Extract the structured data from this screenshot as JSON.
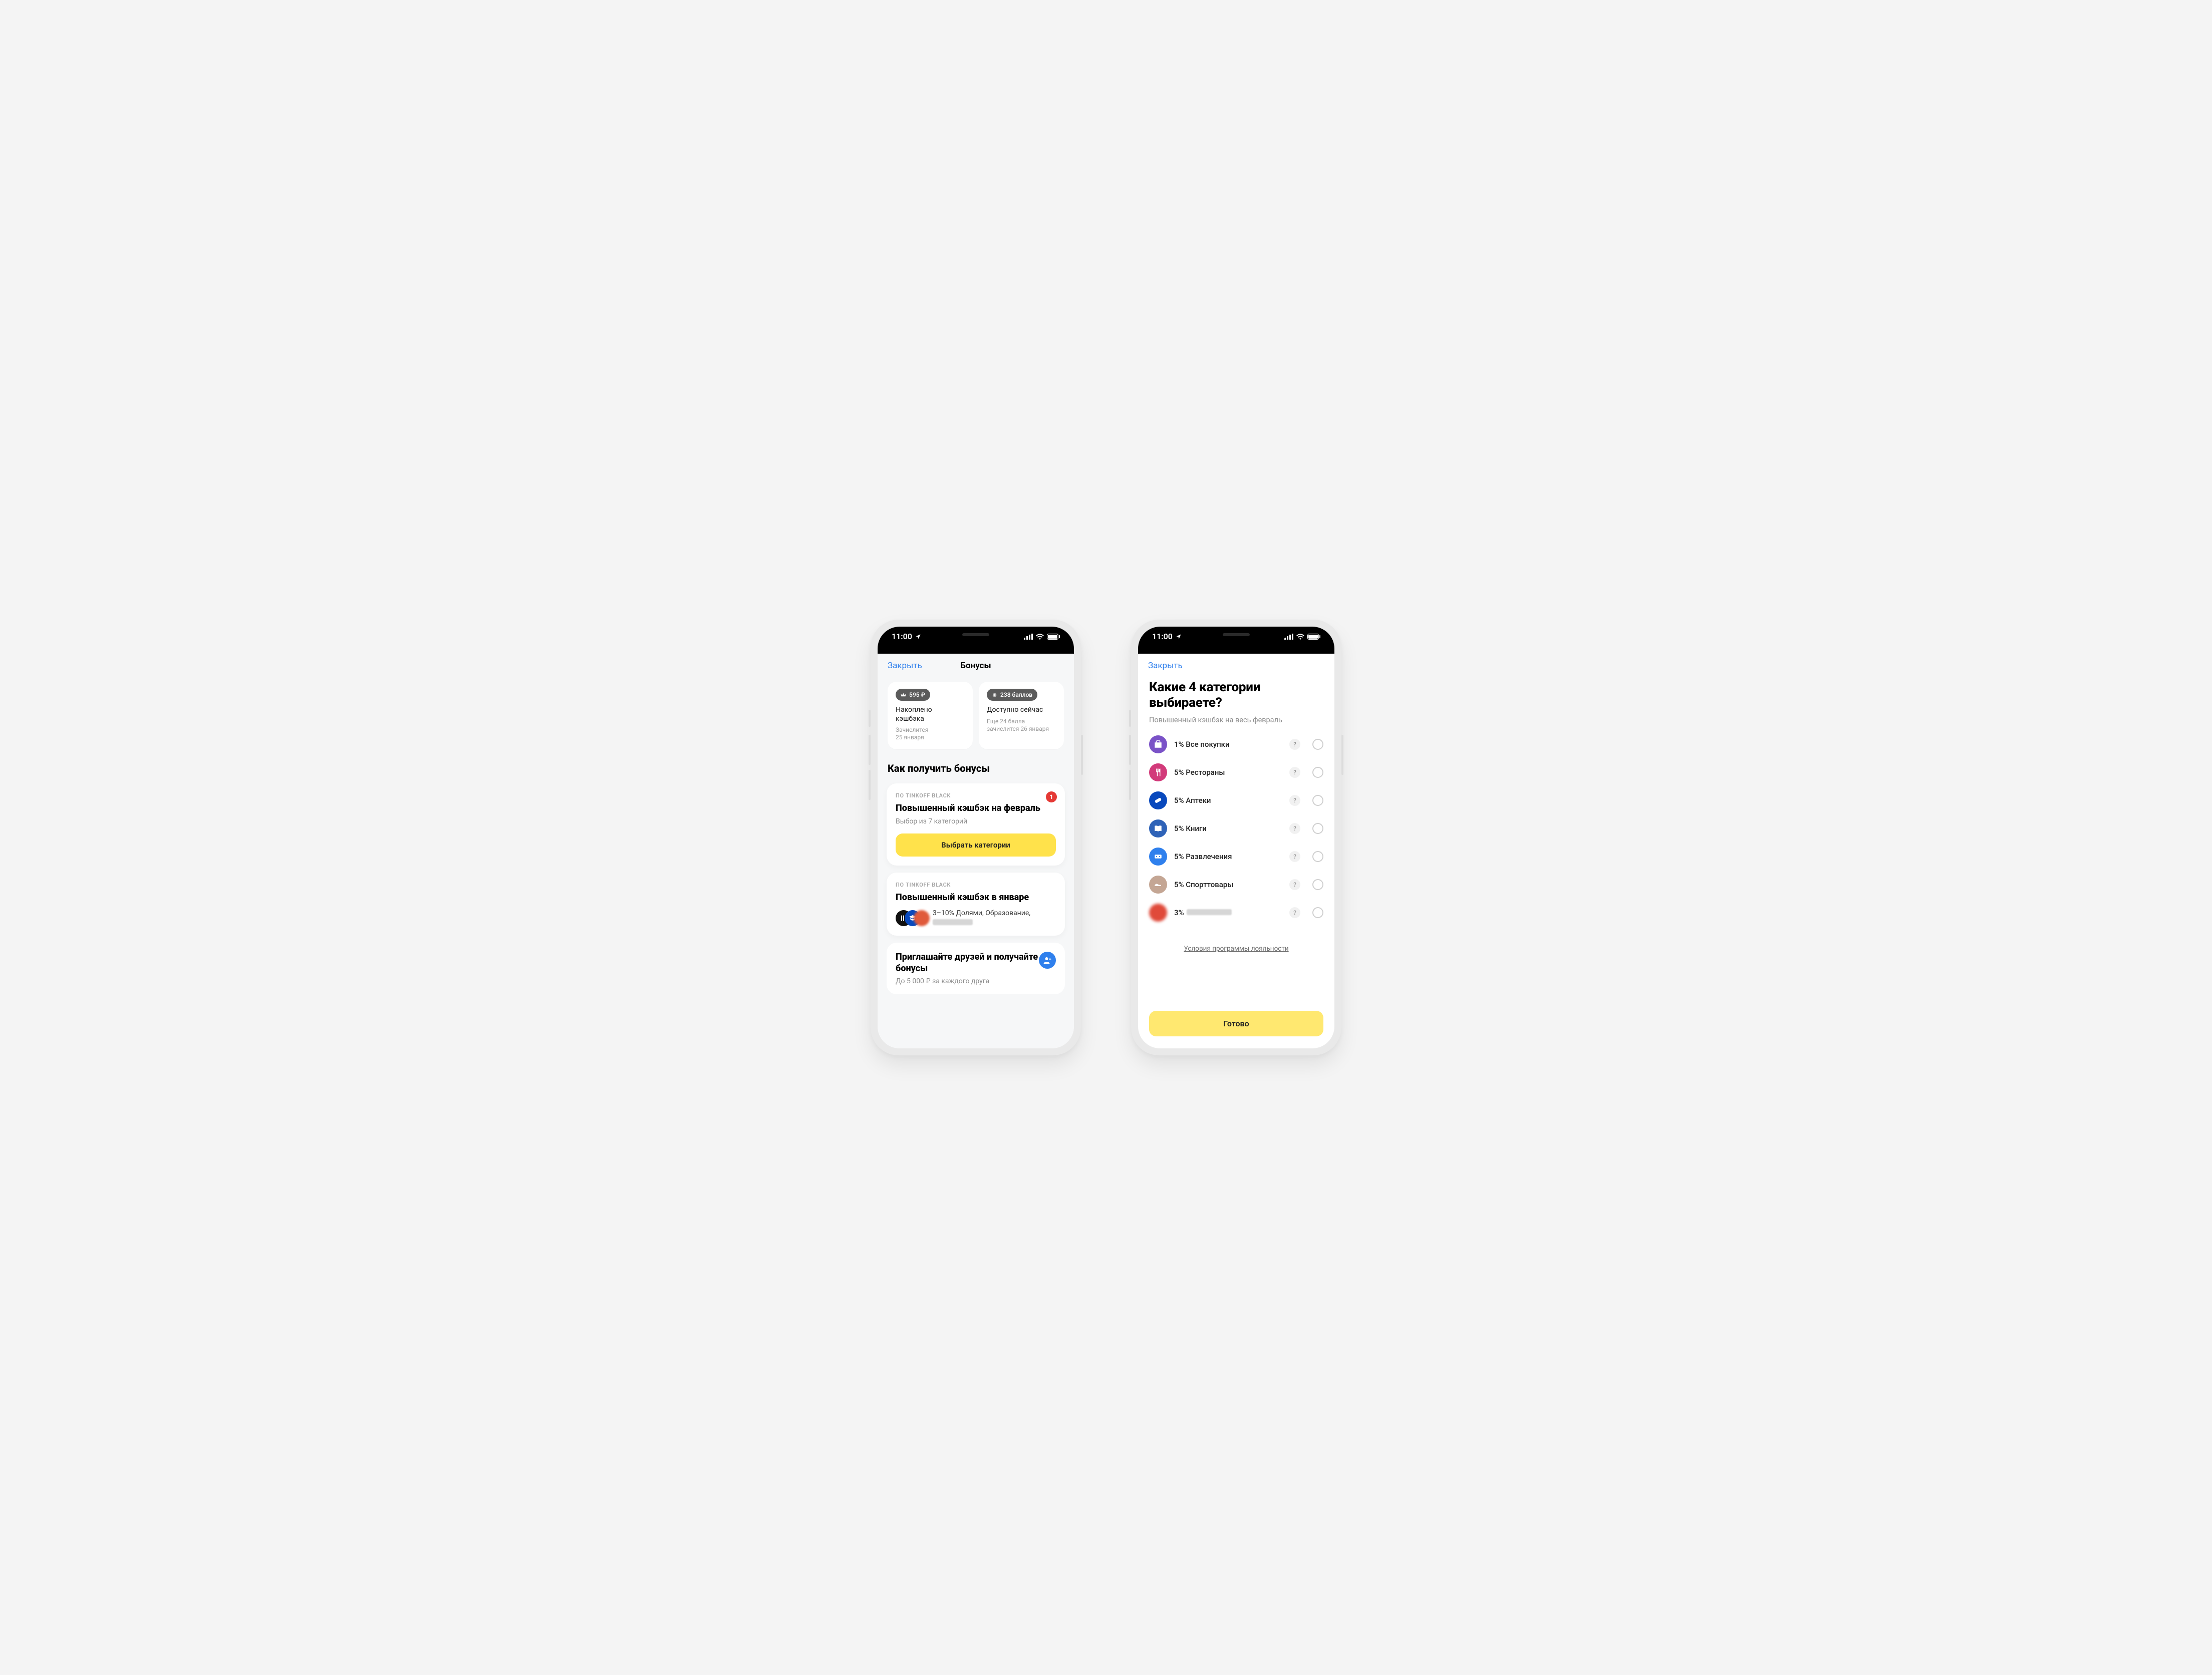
{
  "status_bar": {
    "time": "11:00"
  },
  "left": {
    "close": "Закрыть",
    "title": "Бонусы",
    "card_cashback": {
      "pill": "595 ₽",
      "label": "Накоплено\nкэшбэка",
      "sub": "Зачислится\n25 января"
    },
    "card_points": {
      "pill": "238 баллов",
      "label": "Доступно сейчас",
      "sub": "Еще 24 балла зачислится 26 января"
    },
    "section_header": "Как получить бонусы",
    "promo_feb": {
      "eyebrow": "ПО TINKOFF BLACK",
      "badge": "1",
      "title": "Повышенный кэшбэк на февраль",
      "sub": "Выбор из 7 категорий",
      "cta": "Выбрать категории"
    },
    "promo_jan": {
      "eyebrow": "ПО TINKOFF BLACK",
      "title": "Повышенный кэшбэк в январе",
      "desc": "3–10% Долями, Образование, "
    },
    "invite": {
      "title": "Приглашайте друзей и получайте бонусы",
      "sub": "До 5 000 ₽ за каждого друга"
    }
  },
  "right": {
    "close": "Закрыть",
    "heading": "Какие 4 категории выбираете?",
    "sub": "Повышенный кэшбэк на весь февраль",
    "categories": [
      {
        "label": "1% Все покупки",
        "color": "#7a52c7",
        "icon": "bag"
      },
      {
        "label": "5% Рестораны",
        "color": "#d23a7a",
        "icon": "food"
      },
      {
        "label": "5% Аптеки",
        "color": "#0949bd",
        "icon": "pill"
      },
      {
        "label": "5% Книги",
        "color": "#2f63b8",
        "icon": "book"
      },
      {
        "label": "5% Развлечения",
        "color": "#2f80ed",
        "icon": "ticket"
      },
      {
        "label": "5% Спорттовары",
        "color": "#c4a694",
        "icon": "shoe"
      },
      {
        "label": "3% ",
        "color": "#e04a3a",
        "icon": "blur",
        "blurred": true
      }
    ],
    "terms": "Условия программы лояльности",
    "done": "Готово"
  }
}
